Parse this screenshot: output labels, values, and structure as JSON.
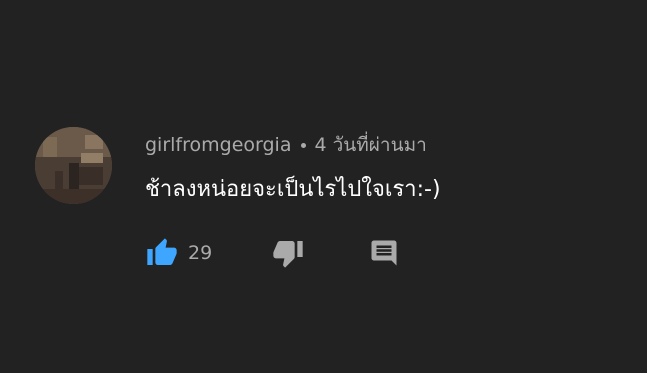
{
  "comment": {
    "author": "girlfromgeorgia",
    "separator": "•",
    "timestamp": "4 วันที่ผ่านมา",
    "text": "ช้าลงหน่อยจะเป็นไรไปใจเรา:-)",
    "likes": "29",
    "liked": true
  },
  "colors": {
    "background": "#222222",
    "like_active": "#3ea6ff",
    "muted": "#aaaaaa",
    "text": "#ffffff"
  },
  "icons": {
    "like": "thumbs-up-icon",
    "dislike": "thumbs-down-icon",
    "reply": "comment-icon"
  }
}
